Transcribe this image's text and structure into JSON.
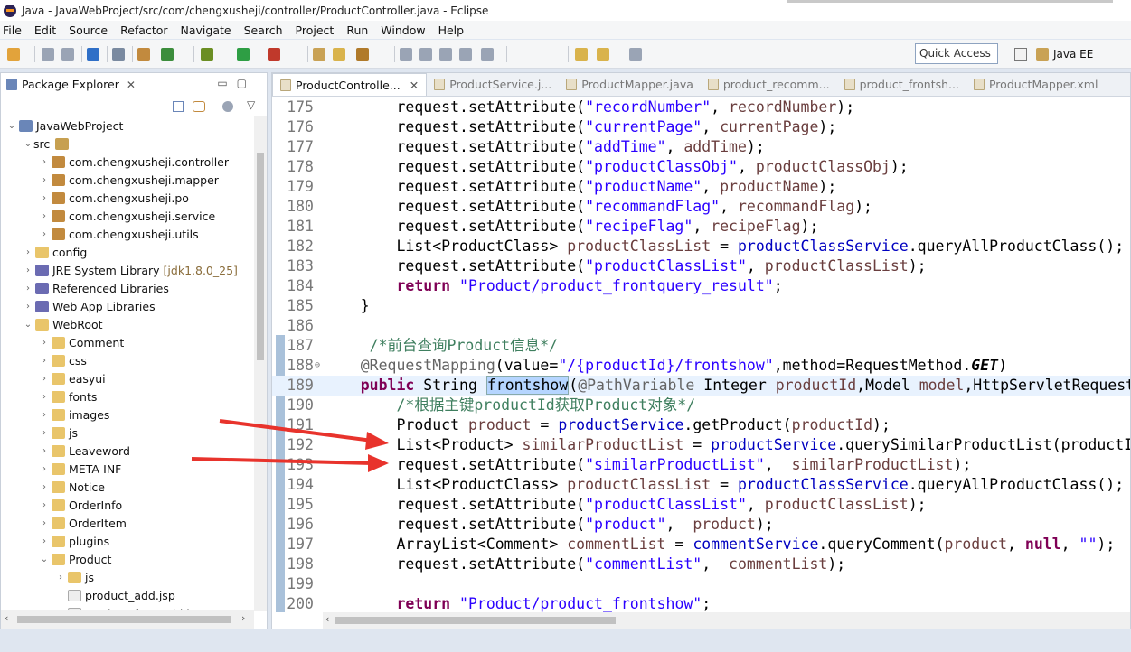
{
  "window": {
    "title": "Java - JavaWebProject/src/com/chengxusheji/controller/ProductController.java - Eclipse"
  },
  "menu": [
    "File",
    "Edit",
    "Source",
    "Refactor",
    "Navigate",
    "Search",
    "Project",
    "Run",
    "Window",
    "Help"
  ],
  "toolbar": {
    "quick_access": "Quick Access",
    "perspective": "Java EE"
  },
  "package_explorer": {
    "title": "Package Explorer",
    "tree": [
      {
        "label": "JavaWebProject",
        "depth": 0,
        "expanded": true,
        "icon": "project-icon"
      },
      {
        "label": "src",
        "depth": 1,
        "expanded": true,
        "icon": "source-folder-icon"
      },
      {
        "label": "com.chengxusheji.controller",
        "depth": 2,
        "expanded": false,
        "icon": "package-icon"
      },
      {
        "label": "com.chengxusheji.mapper",
        "depth": 2,
        "expanded": false,
        "icon": "package-icon"
      },
      {
        "label": "com.chengxusheji.po",
        "depth": 2,
        "expanded": false,
        "icon": "package-icon"
      },
      {
        "label": "com.chengxusheji.service",
        "depth": 2,
        "expanded": false,
        "icon": "package-icon"
      },
      {
        "label": "com.chengxusheji.utils",
        "depth": 2,
        "expanded": false,
        "icon": "package-icon"
      },
      {
        "label": "config",
        "depth": 1,
        "expanded": false,
        "icon": "folder-icon"
      },
      {
        "label": "JRE System Library",
        "suffix": "[jdk1.8.0_25]",
        "depth": 1,
        "expanded": false,
        "icon": "library-icon"
      },
      {
        "label": "Referenced Libraries",
        "depth": 1,
        "expanded": false,
        "icon": "library-icon"
      },
      {
        "label": "Web App Libraries",
        "depth": 1,
        "expanded": false,
        "icon": "library-icon"
      },
      {
        "label": "WebRoot",
        "depth": 1,
        "expanded": true,
        "icon": "folder-icon"
      },
      {
        "label": "Comment",
        "depth": 2,
        "expanded": false,
        "icon": "folder-icon"
      },
      {
        "label": "css",
        "depth": 2,
        "expanded": false,
        "icon": "folder-icon"
      },
      {
        "label": "easyui",
        "depth": 2,
        "expanded": false,
        "icon": "folder-icon"
      },
      {
        "label": "fonts",
        "depth": 2,
        "expanded": false,
        "icon": "folder-icon"
      },
      {
        "label": "images",
        "depth": 2,
        "expanded": false,
        "icon": "folder-icon"
      },
      {
        "label": "js",
        "depth": 2,
        "expanded": false,
        "icon": "folder-icon"
      },
      {
        "label": "Leaveword",
        "depth": 2,
        "expanded": false,
        "icon": "folder-icon"
      },
      {
        "label": "META-INF",
        "depth": 2,
        "expanded": false,
        "icon": "folder-icon"
      },
      {
        "label": "Notice",
        "depth": 2,
        "expanded": false,
        "icon": "folder-icon"
      },
      {
        "label": "OrderInfo",
        "depth": 2,
        "expanded": false,
        "icon": "folder-icon"
      },
      {
        "label": "OrderItem",
        "depth": 2,
        "expanded": false,
        "icon": "folder-icon"
      },
      {
        "label": "plugins",
        "depth": 2,
        "expanded": false,
        "icon": "folder-icon"
      },
      {
        "label": "Product",
        "depth": 2,
        "expanded": true,
        "icon": "folder-icon"
      },
      {
        "label": "js",
        "depth": 3,
        "expanded": false,
        "icon": "folder-icon"
      },
      {
        "label": "product_add.jsp",
        "depth": 3,
        "leaf": true,
        "icon": "jsp-file-icon"
      },
      {
        "label": "product_frontAdd.jsp",
        "depth": 3,
        "leaf": true,
        "icon": "jsp-file-icon"
      }
    ]
  },
  "editor": {
    "tabs": [
      {
        "label": "ProductControlle...",
        "active": true
      },
      {
        "label": "ProductService.j...",
        "active": false
      },
      {
        "label": "ProductMapper.java",
        "active": false
      },
      {
        "label": "product_recomm...",
        "active": false
      },
      {
        "label": "product_frontsh...",
        "active": false
      },
      {
        "label": "ProductMapper.xml",
        "active": false
      }
    ],
    "lines": [
      {
        "n": "175",
        "t": "        request.setAttribute(\"recordNumber\", recordNumber);"
      },
      {
        "n": "176",
        "t": "        request.setAttribute(\"currentPage\", currentPage);"
      },
      {
        "n": "177",
        "t": "        request.setAttribute(\"addTime\", addTime);"
      },
      {
        "n": "178",
        "t": "        request.setAttribute(\"productClassObj\", productClassObj);"
      },
      {
        "n": "179",
        "t": "        request.setAttribute(\"productName\", productName);"
      },
      {
        "n": "180",
        "t": "        request.setAttribute(\"recommandFlag\", recommandFlag);"
      },
      {
        "n": "181",
        "t": "        request.setAttribute(\"recipeFlag\", recipeFlag);"
      },
      {
        "n": "182",
        "t": "        List<ProductClass> productClassList = productClassService.queryAllProductClass();"
      },
      {
        "n": "183",
        "t": "        request.setAttribute(\"productClassList\", productClassList);"
      },
      {
        "n": "184",
        "t": "        return \"Product/product_frontquery_result\";"
      },
      {
        "n": "185",
        "t": "    }"
      },
      {
        "n": "186",
        "t": ""
      },
      {
        "n": "187",
        "t": "     /*前台查询Product信息*/"
      },
      {
        "n": "188",
        "t": "    @RequestMapping(value=\"/{productId}/frontshow\",method=RequestMethod.GET)"
      },
      {
        "n": "189",
        "t": "    public String frontshow(@PathVariable Integer productId,Model model,HttpServletRequest"
      },
      {
        "n": "190",
        "t": "        /*根据主键productId获取Product对象*/"
      },
      {
        "n": "191",
        "t": "        Product product = productService.getProduct(productId);"
      },
      {
        "n": "192",
        "t": "        List<Product> similarProductList = productService.querySimilarProductList(productI"
      },
      {
        "n": "193",
        "t": "        request.setAttribute(\"similarProductList\",  similarProductList);"
      },
      {
        "n": "194",
        "t": "        List<ProductClass> productClassList = productClassService.queryAllProductClass();"
      },
      {
        "n": "195",
        "t": "        request.setAttribute(\"productClassList\", productClassList);"
      },
      {
        "n": "196",
        "t": "        request.setAttribute(\"product\",  product);"
      },
      {
        "n": "197",
        "t": "        ArrayList<Comment> commentList = commentService.queryComment(product, null, \"\");"
      },
      {
        "n": "198",
        "t": "        request.setAttribute(\"commentList\",  commentList);"
      },
      {
        "n": "199",
        "t": ""
      },
      {
        "n": "200",
        "t": "        return \"Product/product_frontshow\";"
      }
    ]
  },
  "colors": {
    "keyword": "#7f0055",
    "string": "#2a00ff",
    "field": "#0000c0",
    "variable": "#6a3e3e",
    "comment": "#3f7f5f",
    "annotation_arrow": "#e8332c"
  }
}
